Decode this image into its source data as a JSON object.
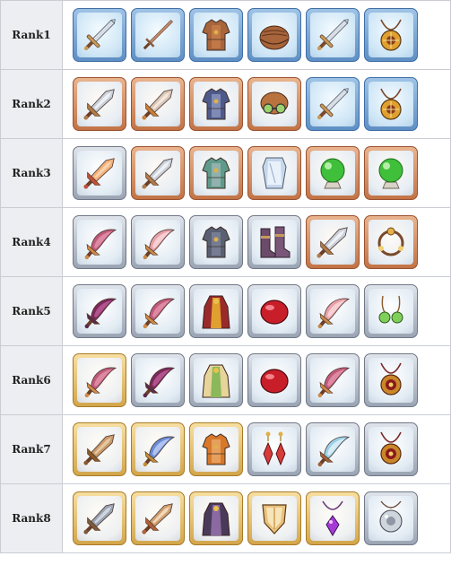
{
  "ranks": [
    {
      "label": "Rank1",
      "items": [
        {
          "icon": "sword-icon",
          "tier": "blue"
        },
        {
          "icon": "thin-sword-icon",
          "tier": "blue"
        },
        {
          "icon": "leather-armor-icon",
          "tier": "blue"
        },
        {
          "icon": "cap-icon",
          "tier": "blue"
        },
        {
          "icon": "sword-icon",
          "tier": "blue"
        },
        {
          "icon": "amulet-icon",
          "tier": "blue"
        }
      ]
    },
    {
      "label": "Rank2",
      "items": [
        {
          "icon": "spear-sword-icon",
          "tier": "bronze"
        },
        {
          "icon": "ornate-sword-icon",
          "tier": "bronze"
        },
        {
          "icon": "chain-armor-icon",
          "tier": "bronze"
        },
        {
          "icon": "goggle-helmet-icon",
          "tier": "bronze"
        },
        {
          "icon": "sword-icon",
          "tier": "blue"
        },
        {
          "icon": "amulet-icon",
          "tier": "blue"
        }
      ]
    },
    {
      "label": "Rank3",
      "items": [
        {
          "icon": "flame-sword-icon",
          "tier": "silver"
        },
        {
          "icon": "spear-sword-icon",
          "tier": "bronze"
        },
        {
          "icon": "plate-armor-icon",
          "tier": "bronze"
        },
        {
          "icon": "crystal-shield-icon",
          "tier": "bronze"
        },
        {
          "icon": "green-orb-icon",
          "tier": "bronze"
        },
        {
          "icon": "green-orb-icon",
          "tier": "bronze"
        }
      ]
    },
    {
      "label": "Rank4",
      "items": [
        {
          "icon": "curved-blade-icon",
          "tier": "silver"
        },
        {
          "icon": "scimitar-icon",
          "tier": "silver"
        },
        {
          "icon": "gargoyle-armor-icon",
          "tier": "silver"
        },
        {
          "icon": "boots-icon",
          "tier": "silver"
        },
        {
          "icon": "spear-sword-icon",
          "tier": "bronze"
        },
        {
          "icon": "bracelet-icon",
          "tier": "bronze"
        }
      ]
    },
    {
      "label": "Rank5",
      "items": [
        {
          "icon": "dark-blade-icon",
          "tier": "silver"
        },
        {
          "icon": "curved-blade-icon",
          "tier": "silver"
        },
        {
          "icon": "royal-robe-icon",
          "tier": "silver"
        },
        {
          "icon": "red-gem-icon",
          "tier": "silver"
        },
        {
          "icon": "scimitar-icon",
          "tier": "silver"
        },
        {
          "icon": "earrings-icon",
          "tier": "silver"
        }
      ]
    },
    {
      "label": "Rank6",
      "items": [
        {
          "icon": "curved-blade-icon",
          "tier": "gold"
        },
        {
          "icon": "dark-blade-icon",
          "tier": "silver"
        },
        {
          "icon": "mage-robe-icon",
          "tier": "silver"
        },
        {
          "icon": "red-gem-icon",
          "tier": "silver"
        },
        {
          "icon": "curved-blade-icon",
          "tier": "silver"
        },
        {
          "icon": "medallion-icon",
          "tier": "silver"
        }
      ]
    },
    {
      "label": "Rank7",
      "items": [
        {
          "icon": "broad-sword-icon",
          "tier": "gold"
        },
        {
          "icon": "lightning-blade-icon",
          "tier": "gold"
        },
        {
          "icon": "royal-armor-icon",
          "tier": "gold"
        },
        {
          "icon": "ruby-earrings-icon",
          "tier": "silver"
        },
        {
          "icon": "ice-blade-icon",
          "tier": "silver"
        },
        {
          "icon": "medallion-icon",
          "tier": "silver"
        }
      ]
    },
    {
      "label": "Rank8",
      "items": [
        {
          "icon": "spiked-blade-icon",
          "tier": "gold"
        },
        {
          "icon": "ornate-spear-icon",
          "tier": "gold"
        },
        {
          "icon": "dark-cloak-icon",
          "tier": "gold"
        },
        {
          "icon": "shield-icon",
          "tier": "gold"
        },
        {
          "icon": "purple-pendant-icon",
          "tier": "gold"
        },
        {
          "icon": "silver-charm-icon",
          "tier": "silver"
        }
      ]
    }
  ]
}
